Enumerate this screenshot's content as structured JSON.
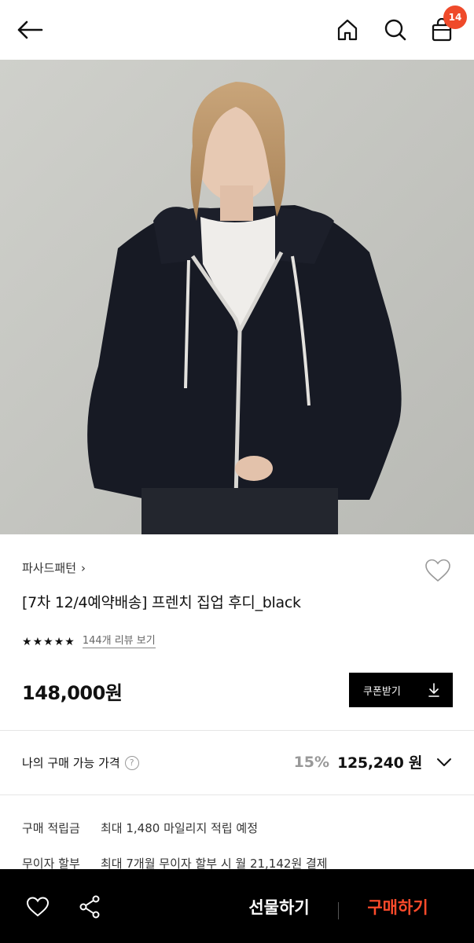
{
  "header": {
    "back_icon": "arrow-left-icon",
    "home_icon": "home-icon",
    "search_icon": "search-icon",
    "cart_icon": "shopping-bag-icon",
    "cart_count": "14",
    "badge_color": "#ef4a2a"
  },
  "product": {
    "brand": "파사드패턴",
    "brand_chevron": "›",
    "title": "[7차 12/4예약배송] 프렌치 집업 후디_black",
    "rating_stars": 5,
    "review_link": "144개 리뷰 보기",
    "price": "148,000원",
    "coupon_label": "쿠폰받기",
    "coupon_icon": "download-icon"
  },
  "my_price": {
    "label": "나의 구매 가능 가격",
    "info_glyph": "?",
    "discount": "15%",
    "final_price": "125,240 원"
  },
  "benefits": [
    {
      "key": "구매 적립금",
      "value": "최대 1,480 마일리지 적립 예정"
    },
    {
      "key": "무이자 할부",
      "value": "최대 7개월 무이자 할부 시 월 21,142원 결제"
    }
  ],
  "bottom_bar": {
    "wish_icon": "heart-icon",
    "share_icon": "share-icon",
    "gift_label": "선물하기",
    "buy_label": "구매하기",
    "buy_color": "#ff4b2b"
  }
}
